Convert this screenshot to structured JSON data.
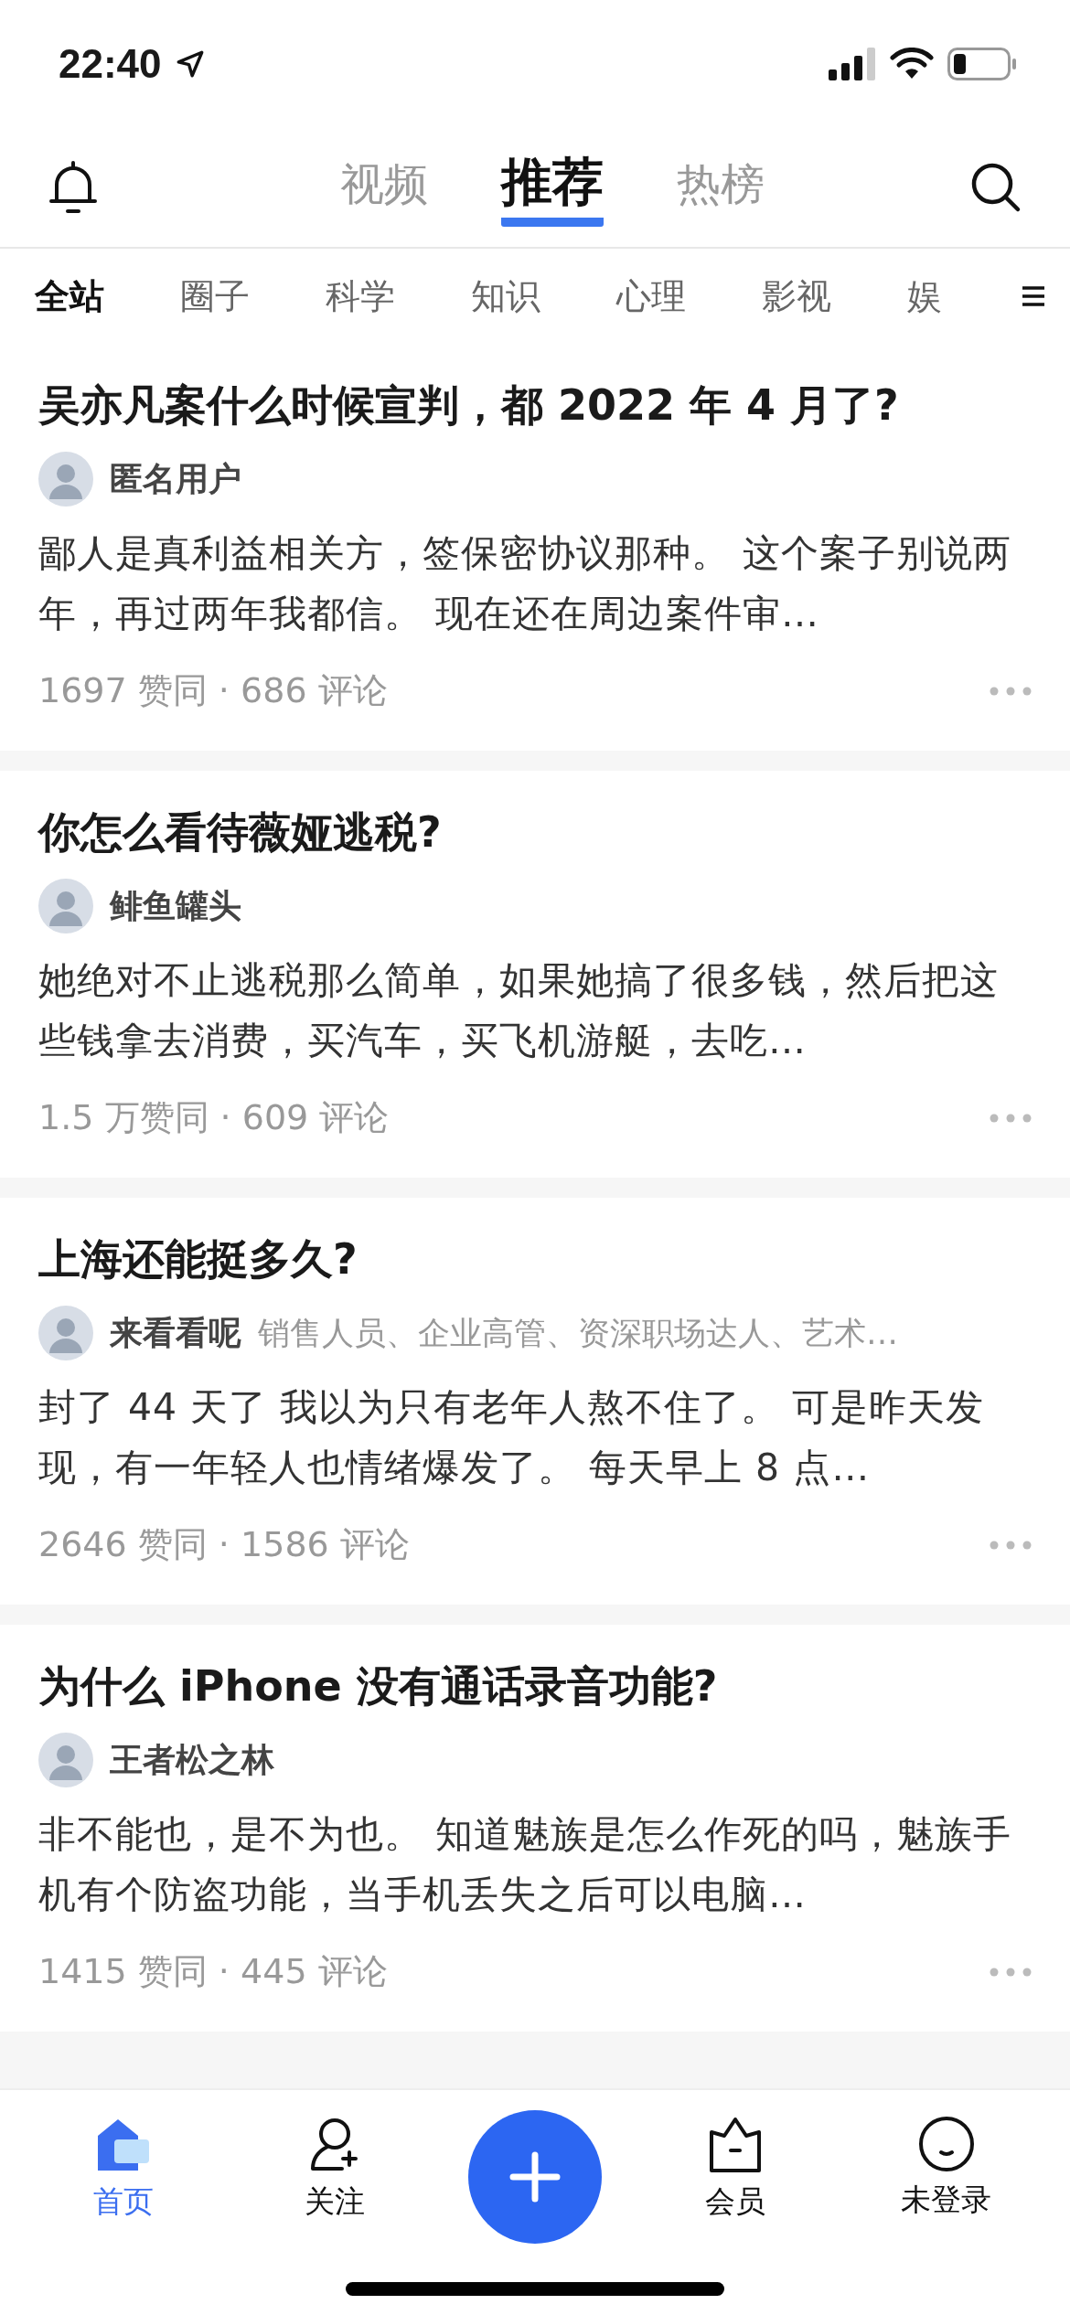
{
  "status_bar": {
    "time": "22:40"
  },
  "top_tabs": [
    {
      "label": "视频",
      "selected": false
    },
    {
      "label": "推荐",
      "selected": true
    },
    {
      "label": "热榜",
      "selected": false
    }
  ],
  "categories": [
    {
      "label": "全站",
      "selected": true
    },
    {
      "label": "圈子",
      "selected": false
    },
    {
      "label": "科学",
      "selected": false
    },
    {
      "label": "知识",
      "selected": false
    },
    {
      "label": "心理",
      "selected": false
    },
    {
      "label": "影视",
      "selected": false
    },
    {
      "label": "娱",
      "selected": false
    }
  ],
  "feed": [
    {
      "title": "吴亦凡案什么时候宣判，都 2022 年 4 月了?",
      "author": "匿名用户",
      "excerpt": "鄙人是真利益相关方，签保密协议那种。 这个案子别说两年，再过两年我都信。 现在还在周边案件审…",
      "stats": "1697 赞同 · 686 评论"
    },
    {
      "title": "你怎么看待薇娅逃税?",
      "author": "鲱鱼罐头",
      "excerpt": "她绝对不止逃税那么简单，如果她搞了很多钱，然后把这些钱拿去消费，买汽车，买飞机游艇，去吃…",
      "stats": "1.5 万赞同 · 609 评论"
    },
    {
      "title": "上海还能挺多久?",
      "author": "来看看呢",
      "tagline": "销售人员、企业高管、资深职场达人、艺术…",
      "excerpt": "封了 44 天了 我以为只有老年人熬不住了。 可是昨天发现，有一年轻人也情绪爆发了。 每天早上 8 点…",
      "stats": "2646 赞同 · 1586 评论"
    },
    {
      "title": "为什么 iPhone 没有通话录音功能?",
      "author": "王者松之林",
      "excerpt": "非不能也，是不为也。 知道魅族是怎么作死的吗，魅族手机有个防盗功能，当手机丢失之后可以电脑…",
      "stats": "1415 赞同 · 445 评论"
    }
  ],
  "bottom_nav": [
    {
      "kind": "home",
      "label": "首页",
      "selected": true
    },
    {
      "kind": "follow",
      "label": "关注",
      "selected": false
    },
    {
      "kind": "plus",
      "selected": false
    },
    {
      "kind": "vip",
      "label": "会员",
      "selected": false
    },
    {
      "kind": "profile",
      "label": "未登录",
      "selected": false
    }
  ]
}
